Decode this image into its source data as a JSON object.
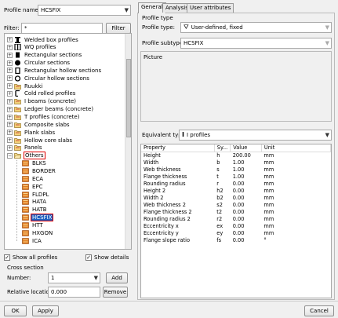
{
  "profile_name": {
    "label": "Profile name:",
    "value": "HCSFIX"
  },
  "filter": {
    "label": "Filter:",
    "value": "*",
    "button": "Filter"
  },
  "tree": [
    {
      "label": "Welded box profiles",
      "expander": "+",
      "icon": "welded-box"
    },
    {
      "label": "WQ profiles",
      "expander": "+",
      "icon": "wq"
    },
    {
      "label": "Rectangular sections",
      "expander": "+",
      "icon": "rect-solid"
    },
    {
      "label": "Circular sections",
      "expander": "+",
      "icon": "circle-solid"
    },
    {
      "label": "Rectangular hollow sections",
      "expander": "+",
      "icon": "rect-hollow"
    },
    {
      "label": "Circular hollow sections",
      "expander": "+",
      "icon": "circle-hollow"
    },
    {
      "label": "Ruukki",
      "expander": "+",
      "icon": "folder"
    },
    {
      "label": "Cold rolled profiles",
      "expander": "+",
      "icon": "cold-rolled"
    },
    {
      "label": "I beams (concrete)",
      "expander": "+",
      "icon": "folder"
    },
    {
      "label": "Ledger beams (concrete)",
      "expander": "+",
      "icon": "folder"
    },
    {
      "label": "T profiles (concrete)",
      "expander": "+",
      "icon": "folder"
    },
    {
      "label": "Composite slabs",
      "expander": "+",
      "icon": "folder"
    },
    {
      "label": "Plank slabs",
      "expander": "+",
      "icon": "folder"
    },
    {
      "label": "Hollow core slabs",
      "expander": "+",
      "icon": "folder"
    },
    {
      "label": "Panels",
      "expander": "+",
      "icon": "folder"
    },
    {
      "label": "Others",
      "expander": "−",
      "icon": "folder-open",
      "boxed": true
    },
    {
      "label": "BLKS",
      "child": true,
      "icon": "user-profile"
    },
    {
      "label": "BORDER",
      "child": true,
      "icon": "user-profile"
    },
    {
      "label": "ECA",
      "child": true,
      "icon": "user-profile"
    },
    {
      "label": "EPC",
      "child": true,
      "icon": "user-profile"
    },
    {
      "label": "FLDPL",
      "child": true,
      "icon": "user-profile"
    },
    {
      "label": "HATA",
      "child": true,
      "icon": "user-profile"
    },
    {
      "label": "HATB",
      "child": true,
      "icon": "user-profile"
    },
    {
      "label": "HCSFIX",
      "child": true,
      "icon": "user-profile",
      "selected": true
    },
    {
      "label": "HTT",
      "child": true,
      "icon": "user-profile"
    },
    {
      "label": "HXGON",
      "child": true,
      "icon": "user-profile"
    },
    {
      "label": "ICA",
      "child": true,
      "icon": "user-profile"
    }
  ],
  "show_all_profiles": {
    "label": "Show all profiles",
    "checked": true
  },
  "show_details": {
    "label": "Show details",
    "checked": true
  },
  "cross_section": {
    "title": "Cross section",
    "number_label": "Number:",
    "number_value": "1",
    "add_button": "Add",
    "relative_label": "Relative location:",
    "relative_value": "0.000",
    "remove_button": "Remove"
  },
  "tabs": [
    "General",
    "Analysis",
    "User attributes"
  ],
  "profile_type_group": {
    "title": "Profile type",
    "type_label": "Profile type:",
    "type_value": "User-defined, fixed",
    "subtype_label": "Profile subtype:",
    "subtype_value": "HCSFIX"
  },
  "picture_label": "Picture",
  "equivalent_type": {
    "label": "Equivalent type:",
    "value": "I profiles"
  },
  "properties": {
    "headers": [
      "Property",
      "Sy...",
      "Value",
      "Unit"
    ],
    "rows": [
      [
        "Height",
        "h",
        "200.00",
        "mm"
      ],
      [
        "Width",
        "b",
        "1.00",
        "mm"
      ],
      [
        "Web thickness",
        "s",
        "1.00",
        "mm"
      ],
      [
        "Flange thickness",
        "t",
        "1.00",
        "mm"
      ],
      [
        "Rounding radius",
        "r",
        "0.00",
        "mm"
      ],
      [
        "Height 2",
        "h2",
        "0.00",
        "mm"
      ],
      [
        "Width 2",
        "b2",
        "0.00",
        "mm"
      ],
      [
        "Web thickness 2",
        "s2",
        "0.00",
        "mm"
      ],
      [
        "Flange thickness 2",
        "t2",
        "0.00",
        "mm"
      ],
      [
        "Rounding radius 2",
        "r2",
        "0.00",
        "mm"
      ],
      [
        "Eccentricity x",
        "ex",
        "0.00",
        "mm"
      ],
      [
        "Eccentricity y",
        "ey",
        "0.00",
        "mm"
      ],
      [
        "Flange slope ratio",
        "fs",
        "0.00",
        "°"
      ]
    ]
  },
  "footer": {
    "ok": "OK",
    "apply": "Apply",
    "cancel": "Cancel"
  },
  "colors": {
    "highlight": "#e00000",
    "selection": "#2060c0"
  }
}
